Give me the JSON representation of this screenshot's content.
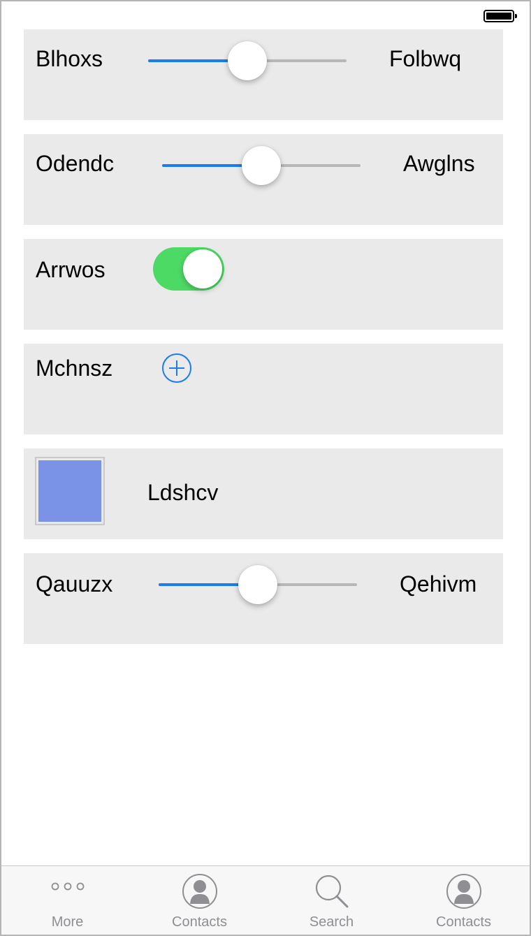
{
  "rows": [
    {
      "type": "slider",
      "left_label": "Blhoxs",
      "right_label": "Folbwq",
      "value": 0.5
    },
    {
      "type": "slider",
      "left_label": "Odendc",
      "right_label": "Awglns",
      "value": 0.5
    },
    {
      "type": "toggle",
      "label": "Arrwos",
      "on": true
    },
    {
      "type": "add",
      "label": "Mchnsz",
      "icon": "plus-circle-icon"
    },
    {
      "type": "swatch",
      "label": "Ldshcv",
      "color": "#7b93e6"
    },
    {
      "type": "slider",
      "left_label": "Qauuzx",
      "right_label": "Qehivm",
      "value": 0.5
    }
  ],
  "tabs": [
    {
      "label": "More",
      "icon": "more-dots-icon"
    },
    {
      "label": "Contacts",
      "icon": "contact-person-icon"
    },
    {
      "label": "Search",
      "icon": "search-icon"
    },
    {
      "label": "Contacts",
      "icon": "contact-person-icon"
    }
  ],
  "colors": {
    "accent": "#1a7cf0",
    "toggle_on": "#4cd964",
    "row_background": "#eaeaea",
    "tab_inactive": "#8e8e93"
  }
}
